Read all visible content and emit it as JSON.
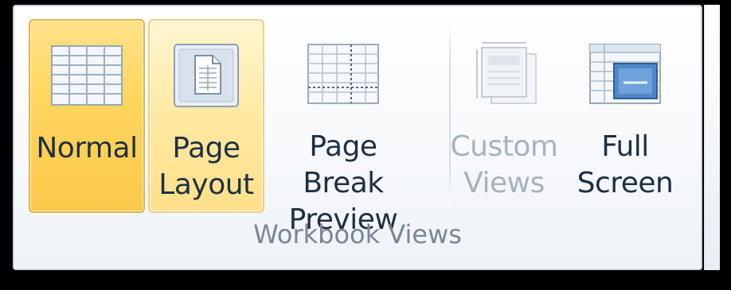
{
  "group": {
    "title": "Workbook Views"
  },
  "buttons": [
    {
      "id": "normal",
      "icon": "grid-icon",
      "line1": "Normal",
      "line2": "",
      "state": "selected"
    },
    {
      "id": "page-layout",
      "icon": "page-layout-icon",
      "line1": "Page",
      "line2": "Layout",
      "state": "hover"
    },
    {
      "id": "page-break-preview",
      "icon": "page-break-icon",
      "line1": "Page Break",
      "line2": "Preview",
      "state": "normal"
    },
    {
      "id": "custom-views",
      "icon": "custom-views-icon",
      "line1": "Custom",
      "line2": "Views",
      "state": "disabled"
    },
    {
      "id": "full-screen",
      "icon": "full-screen-icon",
      "line1": "Full",
      "line2": "Screen",
      "state": "normal"
    }
  ],
  "colors": {
    "selected_fill": "#ffd65e",
    "hover_fill": "#ffe9a3",
    "label_text": "#1f2f42",
    "disabled_text": "#a9b2bd",
    "group_title_text": "#7b8694"
  }
}
